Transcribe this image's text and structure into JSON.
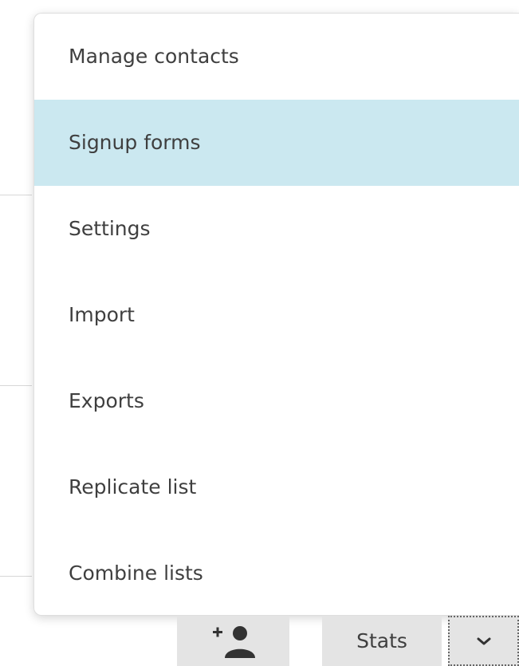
{
  "menu": {
    "items": [
      {
        "label": "Manage contacts",
        "active": false
      },
      {
        "label": "Signup forms",
        "active": true
      },
      {
        "label": "Settings",
        "active": false
      },
      {
        "label": "Import",
        "active": false
      },
      {
        "label": "Exports",
        "active": false
      },
      {
        "label": "Replicate list",
        "active": false
      },
      {
        "label": "Combine lists",
        "active": false
      }
    ],
    "highlight_color": "#cbe8f0"
  },
  "toolbar": {
    "add_contact_icon": "add-user-icon",
    "stats_label": "Stats",
    "dropdown_icon": "chevron-down-icon"
  }
}
